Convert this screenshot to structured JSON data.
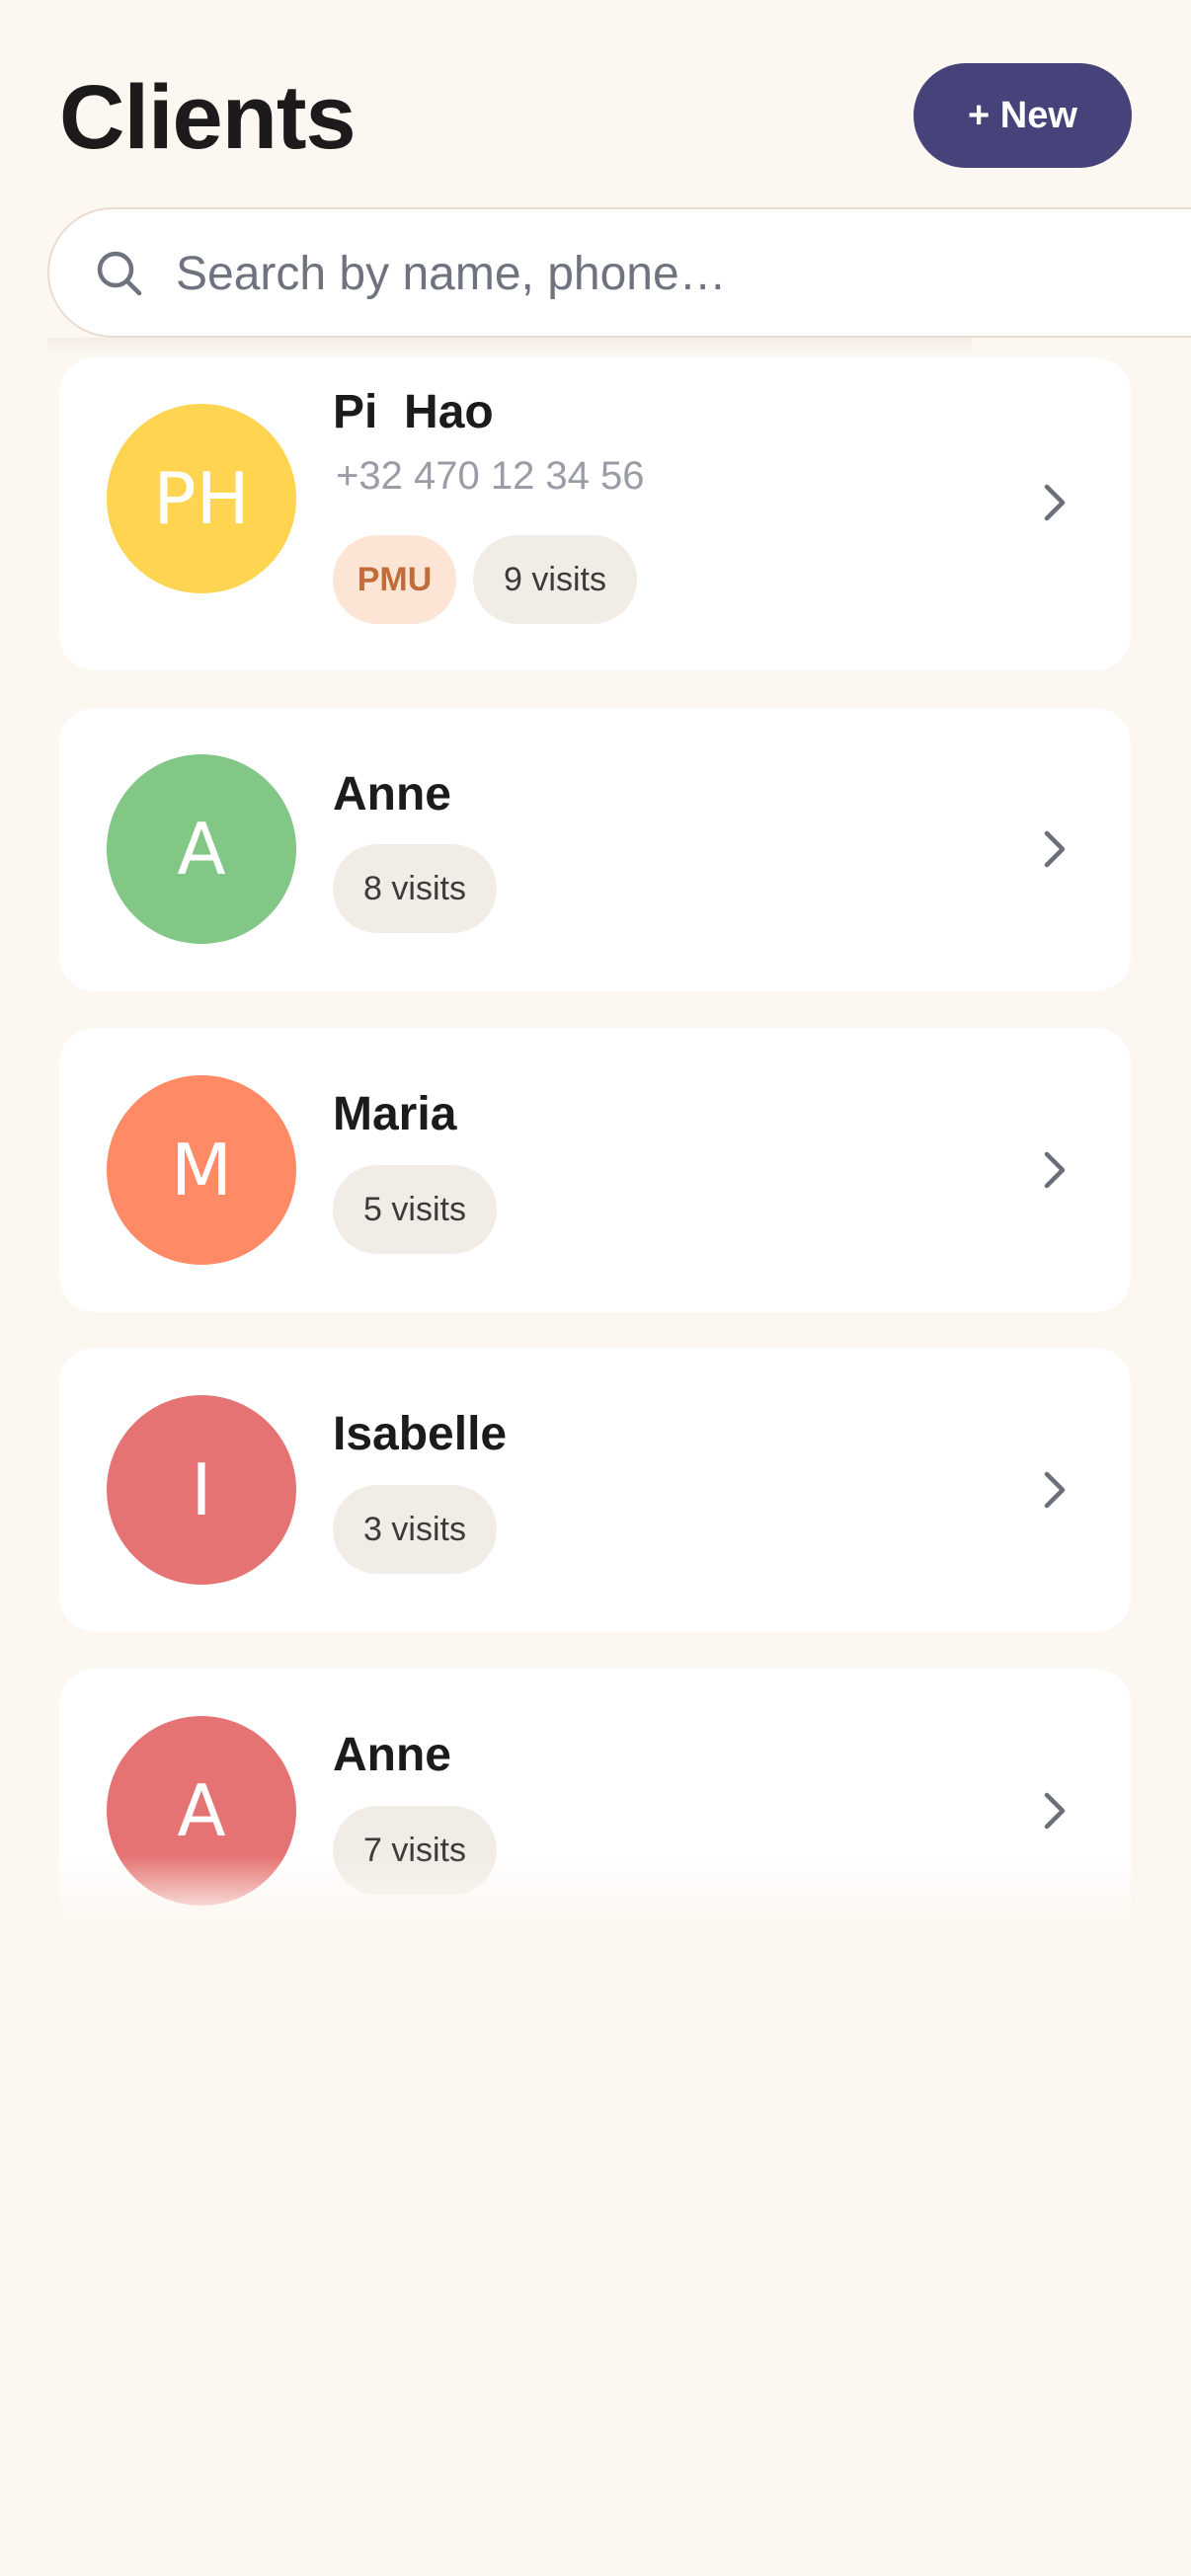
{
  "header": {
    "title": "Clients",
    "new_button_label": "+ New"
  },
  "search": {
    "placeholder": "Search by name, phone…",
    "value": ""
  },
  "clients": [
    {
      "initials": "PH",
      "name": "Pi  Hao",
      "phone": "+32 470 12 34 56",
      "tag": "PMU",
      "visits": "9 visits",
      "avatar_color": "#ffd451"
    },
    {
      "initials": "A",
      "name": "Anne",
      "visits": "8 visits",
      "avatar_color": "#82c785"
    },
    {
      "initials": "M",
      "name": "Maria",
      "visits": "5 visits",
      "avatar_color": "#ff8a65"
    },
    {
      "initials": "I",
      "name": "Isabelle",
      "visits": "3 visits",
      "avatar_color": "#e57373"
    },
    {
      "initials": "A",
      "name": "Anne",
      "visits": "7 visits",
      "avatar_color": "#e57373"
    }
  ],
  "icons": {
    "search": "search-icon",
    "row_action": "chevron-right-icon"
  },
  "colors": {
    "background": "#fcf7f1",
    "accent": "#45437a",
    "badge_visits_bg": "#f2ece6",
    "badge_tag_bg": "#fde5d6",
    "badge_tag_text": "#c06d3a"
  }
}
